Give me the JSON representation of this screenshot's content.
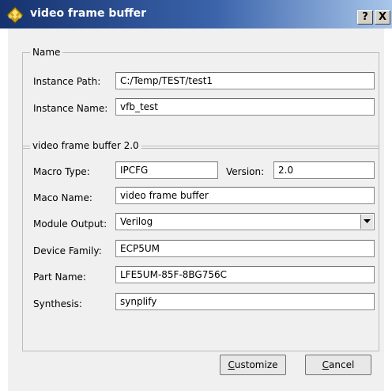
{
  "window": {
    "title": "video frame buffer",
    "help_button": "?",
    "close_button": "X"
  },
  "name_group": {
    "legend": "Name",
    "instance_path_label": "Instance Path:",
    "instance_path_value": "C:/Temp/TEST/test1",
    "instance_name_label": "Instance Name:",
    "instance_name_value": "vfb_test"
  },
  "ip_group": {
    "legend": "video frame buffer 2.0",
    "macro_type_label": "Macro Type:",
    "macro_type_value": "IPCFG",
    "version_label": "Version:",
    "version_value": "2.0",
    "maco_name_label": "Maco Name:",
    "maco_name_value": "video frame buffer",
    "module_output_label": "Module Output:",
    "module_output_value": "Verilog",
    "device_family_label": "Device Family:",
    "device_family_value": "ECP5UM",
    "part_name_label": "Part Name:",
    "part_name_value": "LFE5UM-85F-8BG756C",
    "synthesis_label": "Synthesis:",
    "synthesis_value": "synplify"
  },
  "buttons": {
    "customize_first": "C",
    "customize_rest": "ustomize",
    "cancel_first": "C",
    "cancel_rest": "ancel"
  },
  "colors": {
    "title_gradient_start": "#16326f",
    "title_gradient_end": "#a9c6ea",
    "dialog_background": "#f0f0f0"
  }
}
